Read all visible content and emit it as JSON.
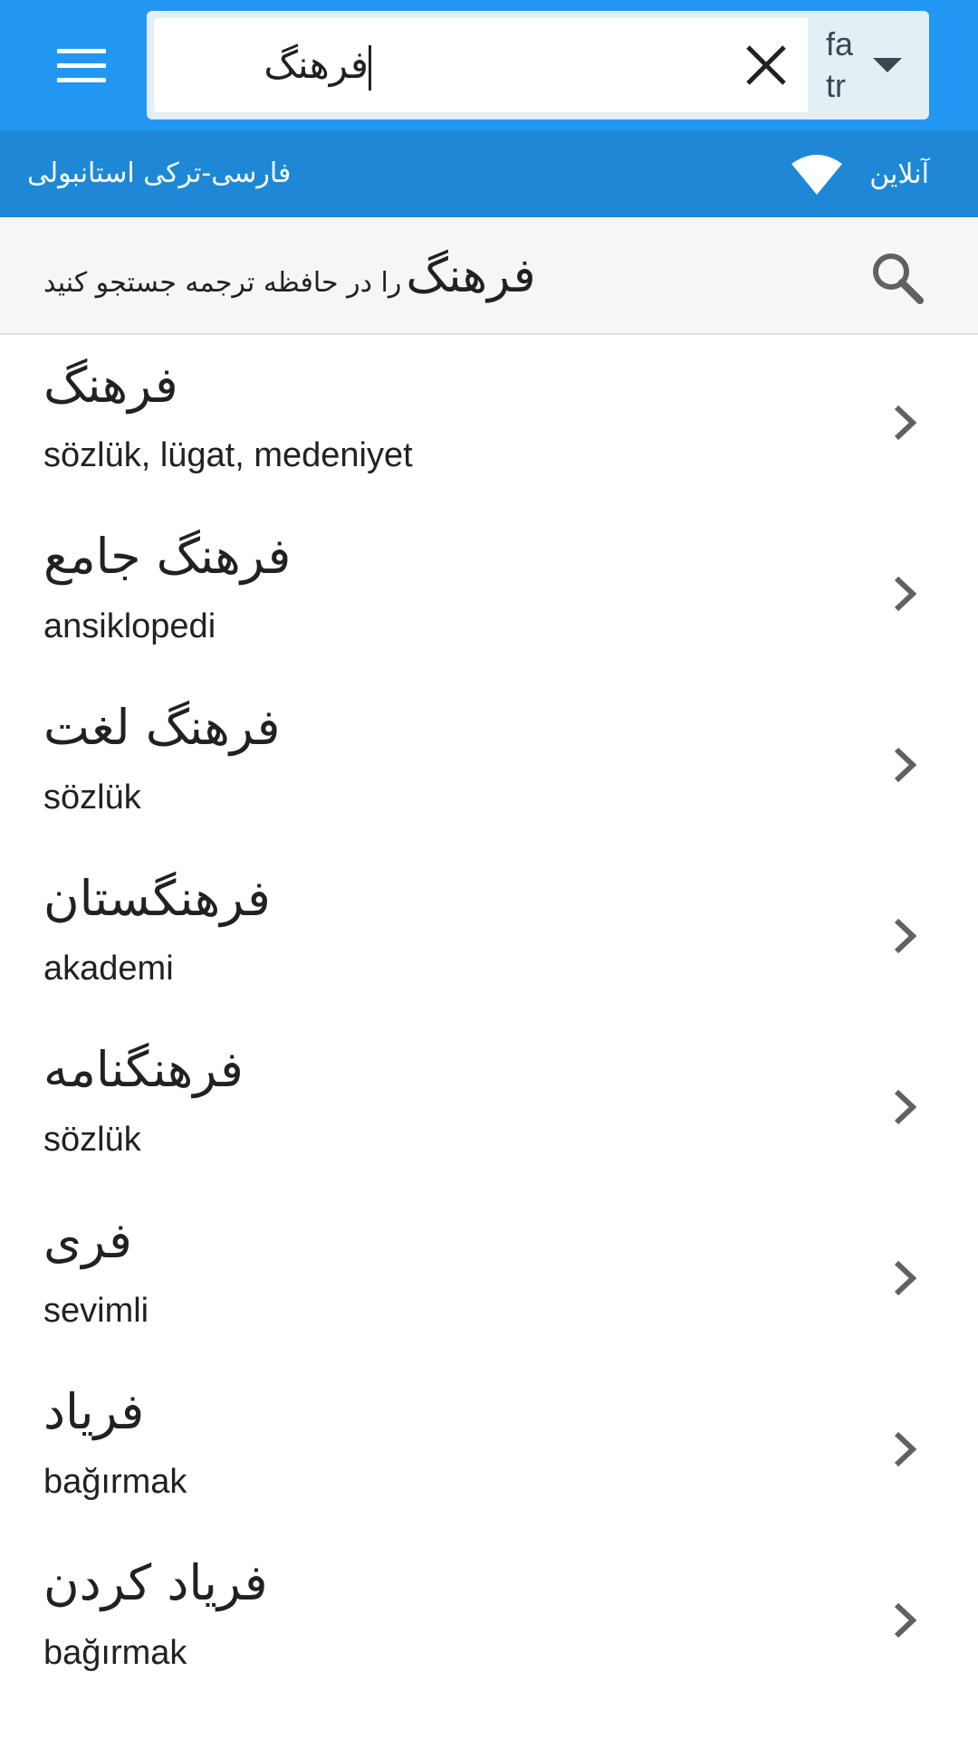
{
  "header": {
    "search_value": "فرهنگ",
    "lang_from": "fa",
    "lang_to": "tr",
    "colors": {
      "appbar": "#2196f3",
      "statusbar": "#1e88d6"
    }
  },
  "status": {
    "dictionary_name": "فارسی-ترکی استانبولی",
    "connection": "آنلاین"
  },
  "tm_search": {
    "word": "فرهنگ",
    "suffix": "را در حافظه ترجمه جستجو کنید"
  },
  "results": [
    {
      "source": "فرهنگ",
      "target": "sözlük, lügat, medeniyet"
    },
    {
      "source": "فرهنگ جامع",
      "target": "ansiklopedi"
    },
    {
      "source": "فرهنگ لغت",
      "target": "sözlük"
    },
    {
      "source": "فرهنگستان",
      "target": "akademi"
    },
    {
      "source": "فرهنگنامه",
      "target": "sözlük"
    },
    {
      "source": "فری",
      "target": "sevimli"
    },
    {
      "source": "فریاد",
      "target": "bağırmak"
    },
    {
      "source": "فریاد کردن",
      "target": "bağırmak"
    }
  ],
  "icons": [
    "menu-icon",
    "close-icon",
    "dropdown-arrow-icon",
    "wifi-icon",
    "search-icon",
    "chevron-right-icon"
  ]
}
